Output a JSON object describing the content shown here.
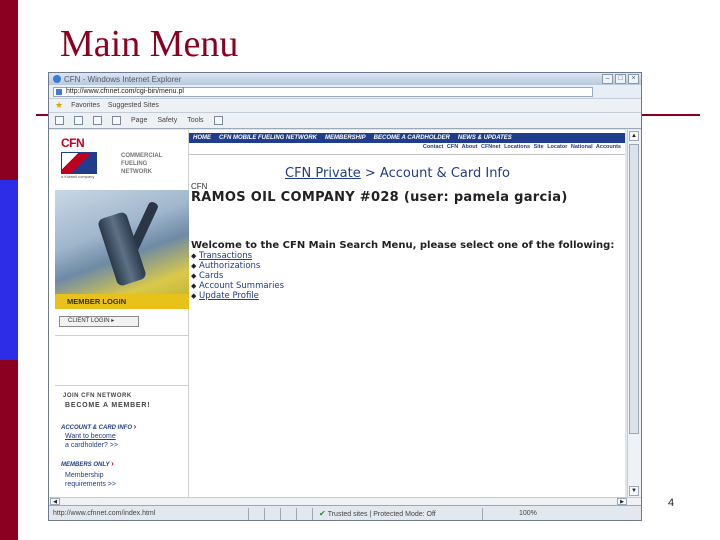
{
  "slide": {
    "title": "Main Menu",
    "page_number": "4",
    "colors": {
      "title": "#8b0021",
      "bar_red": "#8b0021",
      "bar_blue": "#2d2de8"
    }
  },
  "browser": {
    "window_title": "CFN - Windows Internet Explorer",
    "address": "http://www.cfnnet.com/cgi-bin/menu.pl",
    "favorites": [
      "Favorites",
      "Suggested Sites"
    ],
    "command_bar": [
      "Page",
      "Safety",
      "Tools"
    ],
    "status": {
      "url": "http://www.cfnnet.com/index.html",
      "zone": "Trusted sites | Protected Mode: Off",
      "zoom": "100%"
    }
  },
  "site": {
    "logo_text": "CFN",
    "logo_sub": "a Kidwell company",
    "brand_lines": [
      "COMMERCIAL",
      "FUELING",
      "NETWORK"
    ],
    "topnav": [
      "HOME",
      "CFN MOBILE FUELING NETWORK",
      "MEMBERSHIP",
      "BECOME A CARDHOLDER",
      "NEWS & UPDATES"
    ],
    "subnav": [
      "Contact CFN",
      "About CFNnet",
      "Locations",
      "Site Locator",
      "National Accounts"
    ],
    "sidebar": {
      "member_login": "MEMBER LOGIN",
      "client_login": "CLIENT LOGIN",
      "join": "JOIN CFN NETWORK",
      "become": "BECOME A MEMBER!",
      "account_head": "ACCOUNT & CARD INFO",
      "account_link": [
        "Want to become",
        "a cardholder? >>"
      ],
      "members_head": "MEMBERS ONLY",
      "members_link": [
        "Membership",
        "requirements >>"
      ]
    },
    "breadcrumb": {
      "link": "CFN Private",
      "sep": ">",
      "current": "Account & Card Info"
    },
    "cfn_label": "CFN",
    "company": "RAMOS OIL COMPANY #028 (user: pamela garcia)",
    "welcome": "Welcome to the CFN Main Search Menu, please select one of the following:",
    "options": [
      "Transactions",
      "Authorizations",
      "Cards",
      "Account Summaries",
      "Update Profile"
    ]
  }
}
